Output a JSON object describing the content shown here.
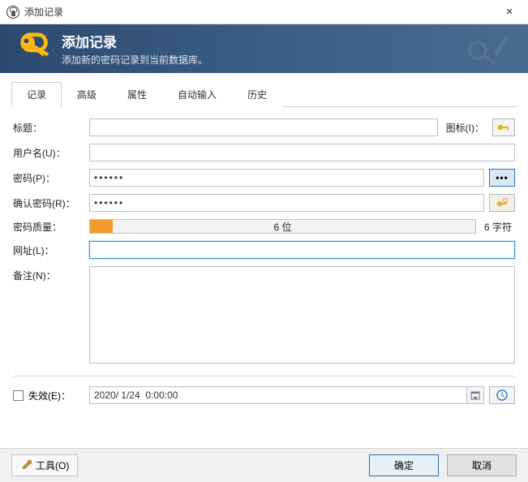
{
  "window": {
    "title": "添加记录",
    "close": "×"
  },
  "header": {
    "title": "添加记录",
    "subtitle": "添加新的密码记录到当前数据库。"
  },
  "tabs": {
    "record": "记录",
    "advanced": "高级",
    "attributes": "属性",
    "autotype": "自动输入",
    "history": "历史"
  },
  "labels": {
    "title": "标题：",
    "icon": "图标(I)：",
    "username": "用户名(U)：",
    "password": "密码(P)：",
    "confirm": "确认密码(R)：",
    "quality": "密码质量：",
    "url": "网址(L)：",
    "notes": "备注(N)：",
    "expire": "失效(E)："
  },
  "values": {
    "title": "",
    "username": "",
    "password": "••••••",
    "confirm": "••••••",
    "url": "",
    "notes": "",
    "expire_date": "2020/ 1/24  0:00:00"
  },
  "quality": {
    "bits": "6 位",
    "chars": "6 字符"
  },
  "buttons": {
    "dots": "•••",
    "tools": "工具(O)",
    "ok": "确定",
    "cancel": "取消"
  }
}
